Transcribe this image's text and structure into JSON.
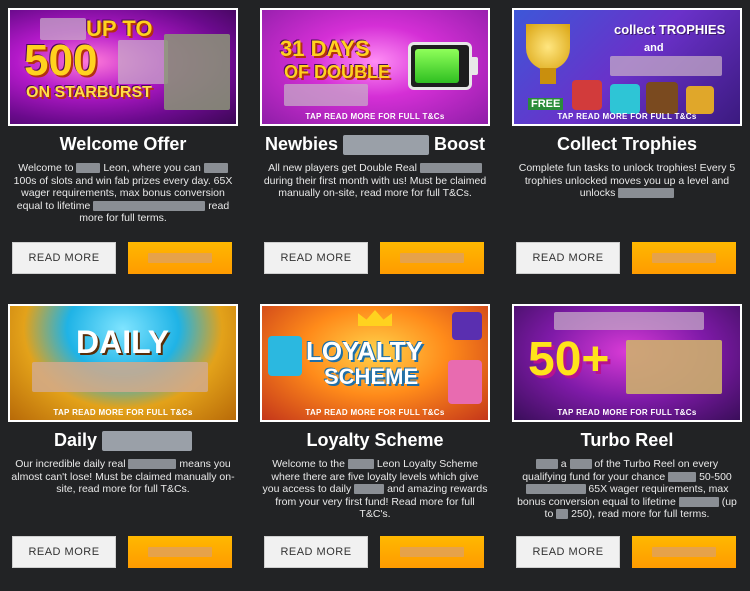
{
  "banner_tap_text": "TAP READ MORE FOR FULL T&Cs",
  "read_more_label": "READ MORE",
  "cards": [
    {
      "title": "Welcome Offer",
      "banner_text_top": "UP TO",
      "banner_text_big": "500",
      "banner_text_sub": "ON STARBURST",
      "desc_parts": [
        "Welcome to",
        "Leon, where you can",
        "100s of slots and win fab prizes every day. 65X wager requirements, max bonus conversion equal to lifetime",
        "read more for full terms."
      ]
    },
    {
      "title_start": "Newbies",
      "title_end": "Boost",
      "banner_text_big": "31 DAYS",
      "banner_text_sub": "OF DOUBLE",
      "desc_parts": [
        "All new players get Double Real",
        "during their first month with us! Must be claimed manually on-site, read more for full T&Cs."
      ]
    },
    {
      "title": "Collect Trophies",
      "banner_text_top": "collect TROPHIES",
      "banner_text_sub": "and",
      "banner_text_free": "FREE",
      "desc_parts": [
        "Complete fun tasks to unlock trophies! Every 5 trophies unlocked moves you up a level and unlocks"
      ]
    },
    {
      "title_start": "Daily",
      "banner_text_big": "DAILY",
      "desc_parts": [
        "Our incredible daily real",
        "means you almost can't lose! Must be claimed manually on-site, read more for full T&Cs."
      ]
    },
    {
      "title": "Loyalty Scheme",
      "banner_text_big": "LOYALTY",
      "banner_text_sub": "SCHEME",
      "desc_parts": [
        "Welcome to the",
        "Leon Loyalty Scheme where there are five loyalty levels which give you access to daily",
        "and amazing rewards from your very first fund! Read more for full T&C's."
      ]
    },
    {
      "title": "Turbo Reel",
      "banner_text_big": "50+",
      "desc_parts": [
        "a",
        "of the Turbo Reel on every qualifying fund for your chance",
        "50-500",
        "65X wager requirements, max bonus conversion equal to lifetime",
        "(up to",
        "250), read more for full terms."
      ]
    }
  ]
}
